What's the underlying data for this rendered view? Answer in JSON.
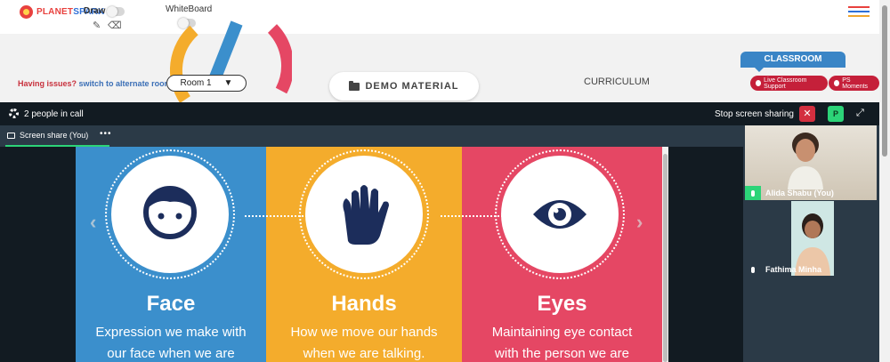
{
  "topbar": {
    "logo_part1": "PLANET",
    "logo_part2": "SPARK",
    "draw_label": "Draw",
    "whiteboard_label": "WhiteBoard",
    "hamburger_colors": [
      "#e8413e",
      "#2e6fd6",
      "#f0a52c"
    ]
  },
  "midbar": {
    "issues_text": "Having issues?",
    "switch_link": "switch to alternate room",
    "room_value": "Room 1",
    "demo_material": "DEMO MATERIAL",
    "curriculum": "CURRICULUM",
    "classroom_tab": "CLASSROOM",
    "live_support": "Live Classroom Support",
    "ps_moments": "PS Moments"
  },
  "call": {
    "people_count": "2 people in call",
    "stop_share": "Stop screen sharing",
    "close_glyph": "✕",
    "participant_btn": "P",
    "share_tab": "Screen share (You)",
    "more": "•••"
  },
  "slide": {
    "panels": [
      {
        "title": "Face",
        "line1": "Expression we make with",
        "line2": "our face when we are",
        "color": "#3b8fcc"
      },
      {
        "title": "Hands",
        "line1": "How we move our hands",
        "line2": "when we are talking.",
        "color": "#f4ac2c"
      },
      {
        "title": "Eyes",
        "line1": "Maintaining eye contact",
        "line2": "with the person we are",
        "color": "#e54764"
      }
    ],
    "icon_color": "#1c2d5b"
  },
  "participants": [
    {
      "name": "Alida Shabu (You)"
    },
    {
      "name": "Fathima Minha"
    }
  ],
  "colors": {
    "accent_green": "#2cd478",
    "accent_red": "#c5203a",
    "accent_blue": "#3a85c6",
    "call_bg": "#121b22"
  }
}
